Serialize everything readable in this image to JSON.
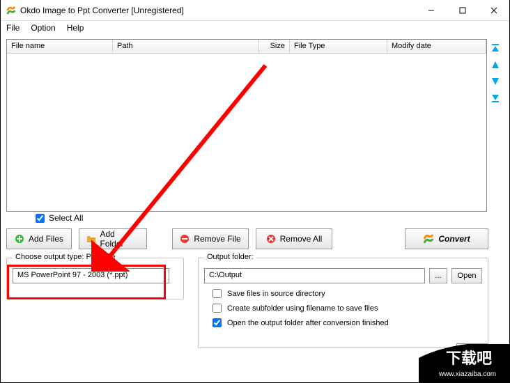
{
  "window": {
    "title": "Okdo Image to Ppt Converter [Unregistered]"
  },
  "menu": {
    "file": "File",
    "option": "Option",
    "help": "Help"
  },
  "columns": {
    "filename": "File name",
    "path": "Path",
    "size": "Size",
    "filetype": "File Type",
    "modify": "Modify date"
  },
  "selectAll": "Select All",
  "buttons": {
    "addFiles": "Add Files",
    "addFolder": "Add Folder",
    "removeFile": "Remove File",
    "removeAll": "Remove All",
    "convert": "Convert",
    "browse": "...",
    "open": "Open"
  },
  "output": {
    "typeLegend": "Choose output type:  PPT File",
    "typeValue": "MS PowerPoint 97 - 2003 (*.ppt)",
    "folderLegend": "Output folder:",
    "folderPath": "C:\\Output",
    "saveInSource": "Save files in source directory",
    "createSubfolder": "Create subfolder using filename to save files",
    "openAfter": "Open the output folder after conversion finished"
  },
  "watermark": {
    "line1": "下载吧",
    "line2": "www.xiazaiba.com"
  }
}
